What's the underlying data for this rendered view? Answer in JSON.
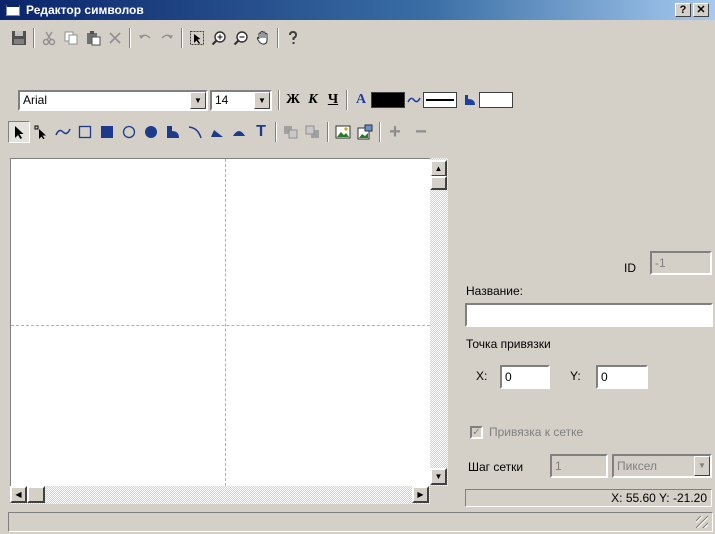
{
  "window": {
    "title": "Редактор символов",
    "help_label": "?",
    "close_label": "✕"
  },
  "toolbar1": {
    "icons": [
      "save-icon",
      "cut-icon",
      "copy-icon",
      "paste-icon",
      "delete-icon",
      "undo-icon",
      "redo-icon",
      "select-icon",
      "zoom-in-icon",
      "zoom-out-icon",
      "pan-hand-icon",
      "help-icon"
    ]
  },
  "toolbar2": {
    "font_value": "Arial",
    "size_value": "14",
    "bold_label": "Ж",
    "italic_label": "К",
    "underline_label": "Ч",
    "text_color_label": "A",
    "text_color": "#000000",
    "line_color": "#ffffff",
    "fill_color": "#ffffff"
  },
  "toolbar3": {
    "text_tool_label": "T",
    "plus_label": "+",
    "minus_label": "−"
  },
  "panel": {
    "id_label": "ID",
    "id_value": "-1",
    "name_label": "Название:",
    "name_value": "",
    "anchor_label": "Точка привязки",
    "x_label": "X:",
    "x_value": "0",
    "y_label": "Y:",
    "y_value": "0",
    "snap_label": "Привязка к сетке",
    "snap_checked": "✓",
    "grid_step_label": "Шаг сетки",
    "grid_step_value": "1",
    "unit_value": "Пиксел"
  },
  "coords": {
    "text": "X: 55.60 Y: -21.20"
  },
  "colors": {
    "accent": "#0a246a",
    "icon_blue": "#1f3f9f",
    "icon_dark": "#1e3a8a"
  }
}
